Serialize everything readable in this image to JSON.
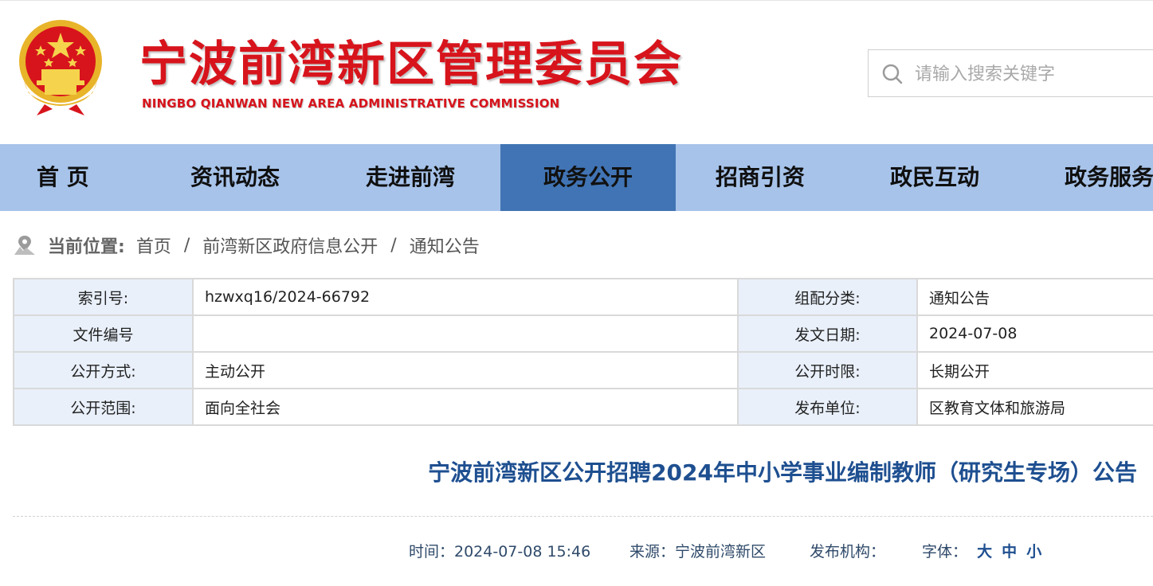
{
  "header": {
    "title": "宁波前湾新区管理委员会",
    "subtitle": "NINGBO QIANWAN NEW AREA ADMINISTRATIVE COMMISSION",
    "emblem_icon": "national-emblem-icon",
    "brand_color": "#d7141c"
  },
  "search": {
    "placeholder": "请输入搜索关键字",
    "icon": "search-icon"
  },
  "nav": {
    "items": [
      {
        "label": "首 页"
      },
      {
        "label": "资讯动态"
      },
      {
        "label": "走进前湾"
      },
      {
        "label": "政务公开"
      },
      {
        "label": "招商引资"
      },
      {
        "label": "政民互动"
      },
      {
        "label": "政务服务"
      }
    ],
    "active_label": "政务公开",
    "bar_color": "#a7c3ea",
    "active_color": "#4174b4"
  },
  "breadcrumb": {
    "icon": "location-icon",
    "label": "当前位置:",
    "items": [
      "首页",
      "前湾新区政府信息公开",
      "通知公告"
    ],
    "separator": "/"
  },
  "info": {
    "rows": [
      {
        "k1": "索引号:",
        "v1": "hzwxq16/2024-66792",
        "k2": "组配分类:",
        "v2": "通知公告"
      },
      {
        "k1": "文件编号",
        "v1": "",
        "k2": "发文日期:",
        "v2": "2024-07-08"
      },
      {
        "k1": "公开方式:",
        "v1": "主动公开",
        "k2": "公开时限:",
        "v2": "长期公开"
      },
      {
        "k1": "公开范围:",
        "v1": "面向全社会",
        "k2": "发布单位:",
        "v2": "区教育文体和旅游局"
      }
    ]
  },
  "article": {
    "title": "宁波前湾新区公开招聘2024年中小学事业编制教师（研究生专场）公告",
    "meta": {
      "time": "时间：2024-07-08 15:46",
      "source": "来源：宁波前湾新区",
      "publisher": "发布机构：",
      "font_label": "字体：",
      "font_large": "大",
      "font_medium": "中",
      "font_small": "小"
    }
  }
}
